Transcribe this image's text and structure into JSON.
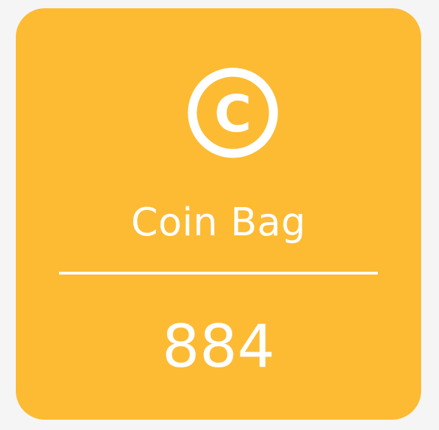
{
  "widget": {
    "icon": "copyright-coin-icon",
    "icon_glyph": "C",
    "label": "Coin Bag",
    "value": "884",
    "background_color": "#fdbb34",
    "foreground_color": "#ffffff"
  }
}
